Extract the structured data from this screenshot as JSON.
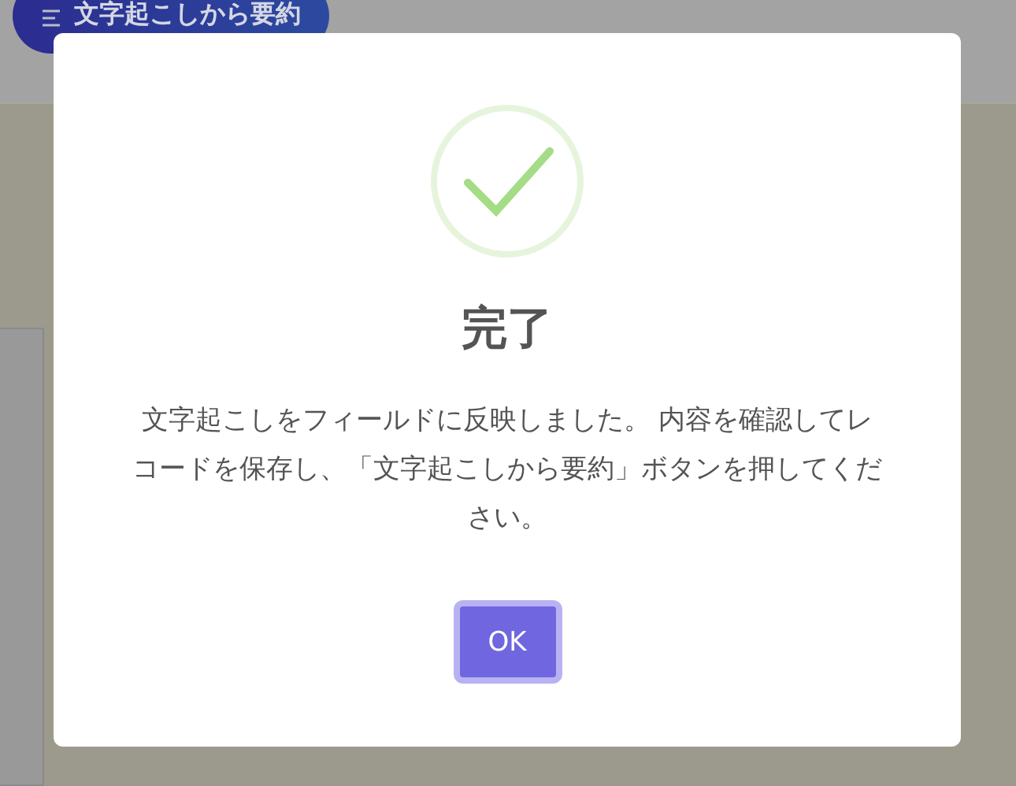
{
  "background": {
    "header_button": {
      "label": "文字起こしから要約"
    }
  },
  "dialog": {
    "title": "完了",
    "message": "文字起こしをフィールドに反映しました。 内容を確認してレコードを保存し、「文字起こしから要約」ボタンを押してください。",
    "buttons": [
      "OK"
    ]
  }
}
